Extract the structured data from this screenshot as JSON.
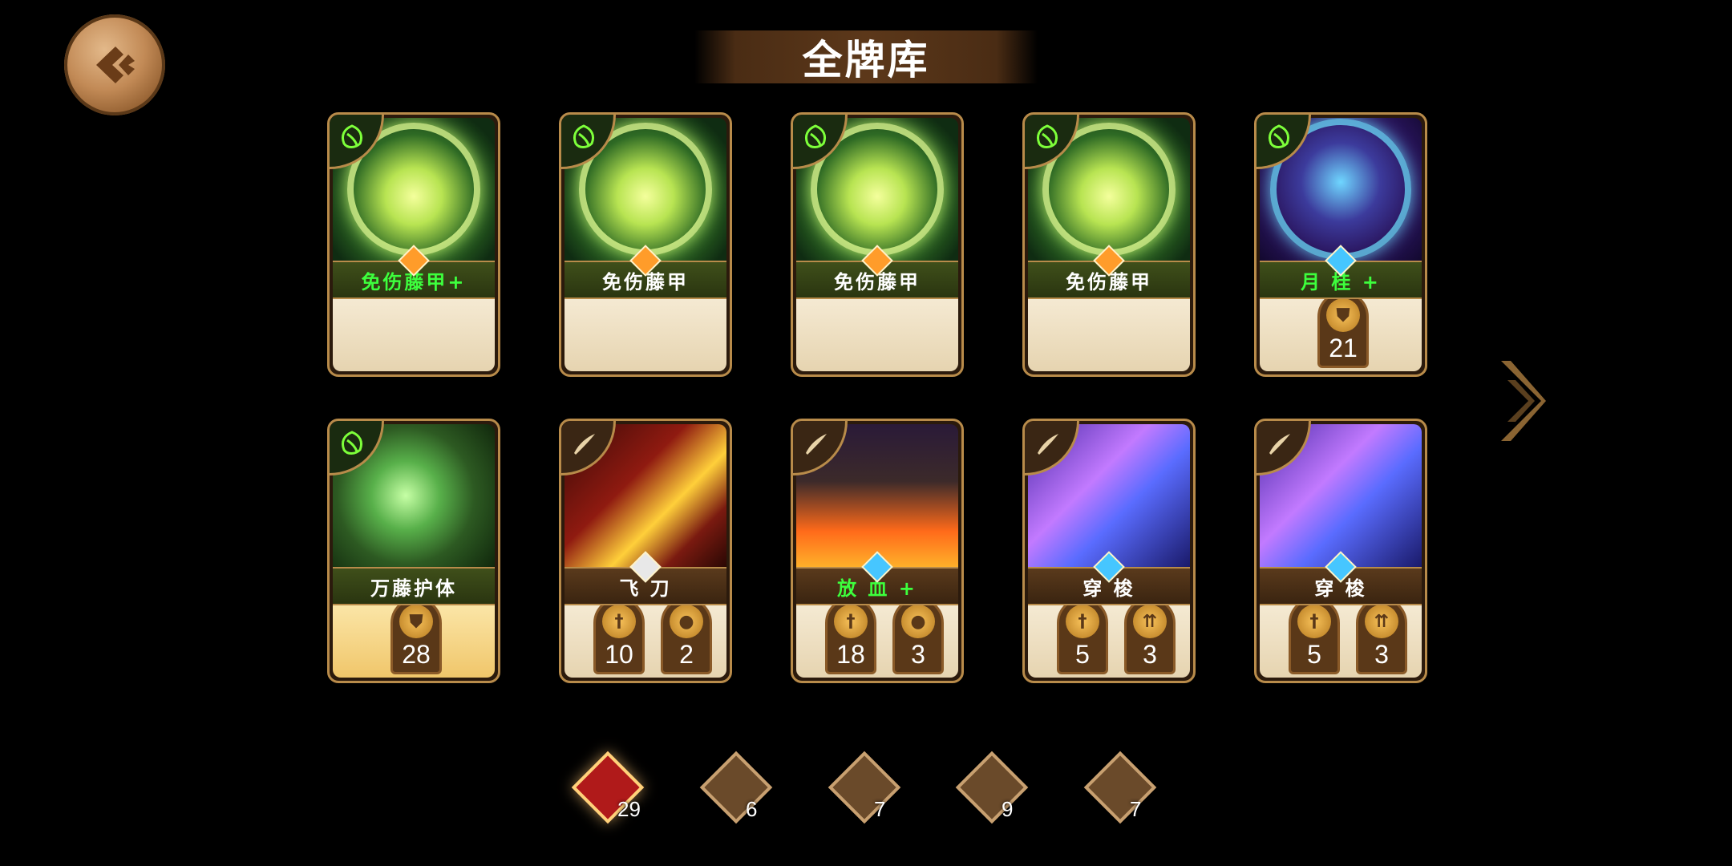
{
  "header": {
    "title": "全牌库"
  },
  "cards": [
    {
      "name": "免伤藤甲+",
      "upgraded": true,
      "type": "defense",
      "gem": "orange",
      "art": "green",
      "stats": []
    },
    {
      "name": "免伤藤甲",
      "upgraded": false,
      "type": "defense",
      "gem": "orange",
      "art": "green",
      "stats": []
    },
    {
      "name": "免伤藤甲",
      "upgraded": false,
      "type": "defense",
      "gem": "orange",
      "art": "green",
      "stats": []
    },
    {
      "name": "免伤藤甲",
      "upgraded": false,
      "type": "defense",
      "gem": "orange",
      "art": "green",
      "stats": []
    },
    {
      "name": "月 桂 +",
      "upgraded": true,
      "type": "defense",
      "gem": "blue",
      "art": "night",
      "stats": [
        {
          "icon": "shield-icon",
          "value": "21"
        }
      ]
    },
    {
      "name": "万藤护体",
      "upgraded": false,
      "type": "defense",
      "gem": "",
      "art": "vine",
      "stats": [
        {
          "icon": "shield-icon",
          "value": "28"
        }
      ]
    },
    {
      "name": "飞 刀",
      "upgraded": false,
      "type": "attack",
      "gem": "white",
      "art": "knife",
      "stats": [
        {
          "icon": "sword-icon",
          "value": "10"
        },
        {
          "icon": "drop-icon",
          "value": "2"
        }
      ]
    },
    {
      "name": "放 血 +",
      "upgraded": true,
      "type": "attack",
      "gem": "blue",
      "art": "blood",
      "stats": [
        {
          "icon": "sword-icon",
          "value": "18"
        },
        {
          "icon": "drop-icon",
          "value": "3"
        }
      ]
    },
    {
      "name": "穿 梭",
      "upgraded": false,
      "type": "attack",
      "gem": "blue",
      "art": "shuttle",
      "stats": [
        {
          "icon": "sword-icon",
          "value": "5"
        },
        {
          "icon": "arrows-icon",
          "value": "3"
        }
      ]
    },
    {
      "name": "穿 梭",
      "upgraded": false,
      "type": "attack",
      "gem": "blue",
      "art": "shuttle",
      "stats": [
        {
          "icon": "sword-icon",
          "value": "5"
        },
        {
          "icon": "arrows-icon",
          "value": "3"
        }
      ]
    }
  ],
  "tabs": [
    {
      "icon": "all-cards-icon",
      "count": "29",
      "active": true
    },
    {
      "icon": "hero-red-hair-icon",
      "count": "6",
      "active": false
    },
    {
      "icon": "hero-hooded-icon",
      "count": "7",
      "active": false
    },
    {
      "icon": "hero-armored-icon",
      "count": "9",
      "active": false
    },
    {
      "icon": "target-icon",
      "count": "7",
      "active": false
    }
  ],
  "colors": {
    "upgraded_text": "#3dff3d",
    "frame": "#b88b4a",
    "background": "#000000"
  }
}
